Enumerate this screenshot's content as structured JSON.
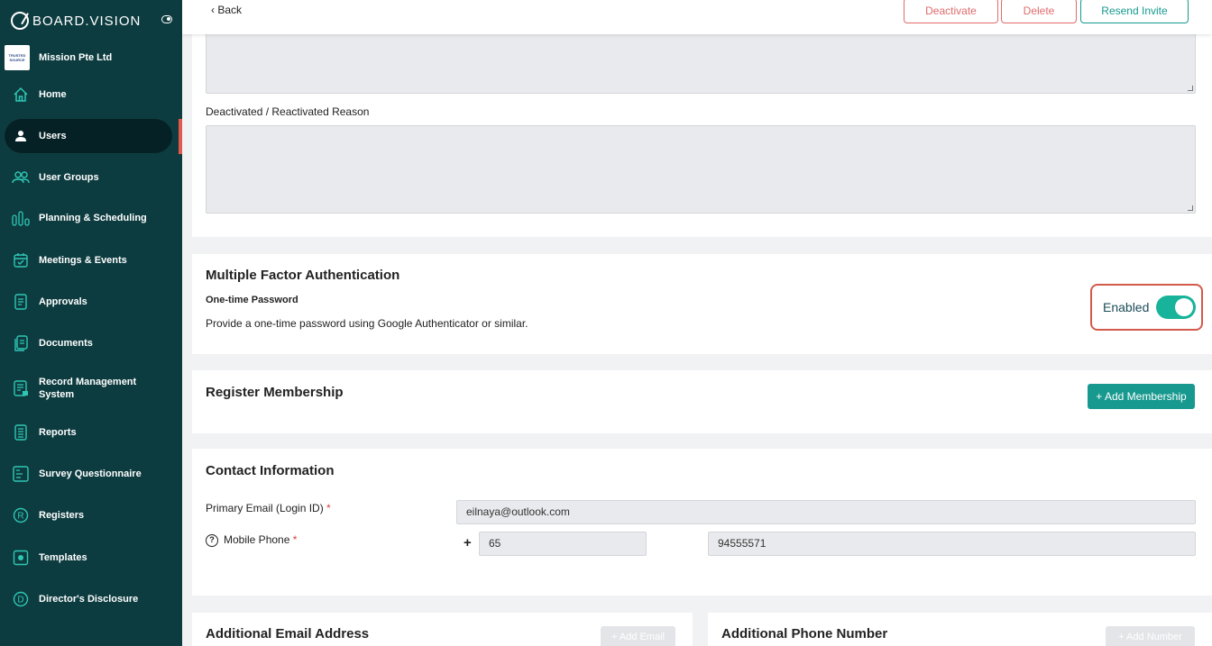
{
  "brand": {
    "name": "BOARD.VISION"
  },
  "org": {
    "logo_text": "TRUSTED SOURCE",
    "name": "Mission Pte Ltd"
  },
  "sidebar": {
    "items": [
      {
        "label": "Home",
        "icon": "home-icon"
      },
      {
        "label": "Users",
        "icon": "user-icon",
        "active": true
      },
      {
        "label": "User Groups",
        "icon": "users-icon"
      },
      {
        "label": "Planning & Scheduling",
        "icon": "bar-chart-icon"
      },
      {
        "label": "Meetings & Events",
        "icon": "calendar-icon"
      },
      {
        "label": "Approvals",
        "icon": "document-icon"
      },
      {
        "label": "Documents",
        "icon": "documents-icon"
      },
      {
        "label": "Record Management System",
        "icon": "record-icon"
      },
      {
        "label": "Reports",
        "icon": "report-icon"
      },
      {
        "label": "Survey Questionnaire",
        "icon": "survey-icon"
      },
      {
        "label": "Registers",
        "icon": "registered-icon"
      },
      {
        "label": "Templates",
        "icon": "template-icon"
      },
      {
        "label": "Director's Disclosure",
        "icon": "disclosure-icon"
      }
    ]
  },
  "topbar": {
    "back_label": "‹  Back",
    "deactivate_label": "Deactivate",
    "delete_label": "Delete",
    "resend_label": "Resend Invite"
  },
  "reason": {
    "label": "Deactivated / Reactivated Reason"
  },
  "mfa": {
    "title": "Multiple Factor Authentication",
    "otp_title": "One-time Password",
    "otp_desc": "Provide a one-time password using Google Authenticator or similar.",
    "status_label": "Enabled",
    "enabled": true
  },
  "membership": {
    "title": "Register Membership",
    "add_label": "+ Add Membership"
  },
  "contact": {
    "title": "Contact Information",
    "email_label": "Primary Email (Login ID)",
    "email_value": "eilnaya@outlook.com",
    "mobile_label": "Mobile Phone",
    "required_mark": "*",
    "help_glyph": "?",
    "plus_sign": "+",
    "country_code": "65",
    "phone_number": "94555571"
  },
  "additional_email": {
    "title": "Additional Email Address",
    "add_label": "+ Add Email"
  },
  "additional_phone": {
    "title": "Additional Phone Number",
    "add_label": "+ Add Number"
  },
  "colors": {
    "sidebar_bg": "#0d3c40",
    "accent": "#17998f",
    "toggle_on": "#17b39a",
    "danger": "#e06b6b",
    "highlight_border": "#d35a4a"
  }
}
